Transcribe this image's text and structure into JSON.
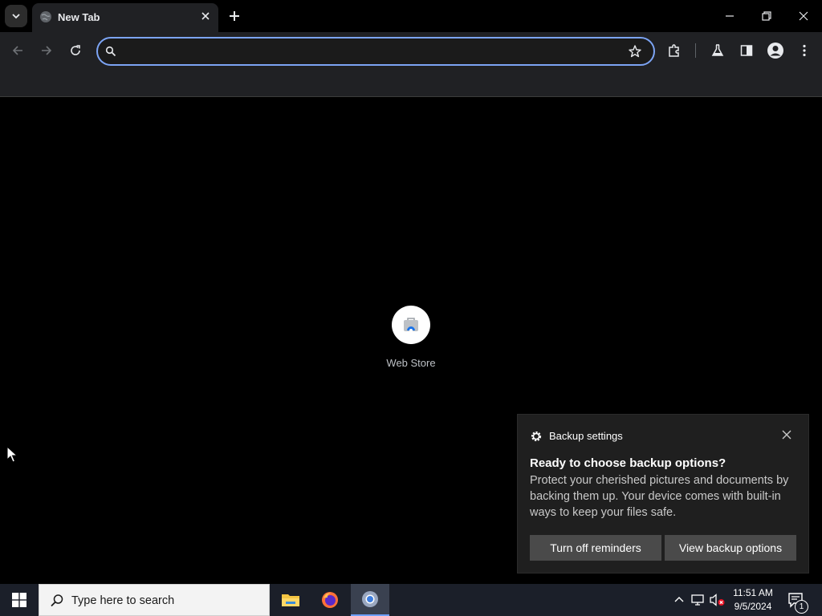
{
  "browser": {
    "tab": {
      "title": "New Tab"
    },
    "omnibox": {
      "value": "",
      "placeholder": ""
    }
  },
  "page": {
    "shortcuts": [
      {
        "label": "Web Store"
      }
    ]
  },
  "notification": {
    "app_name": "Backup settings",
    "heading": "Ready to choose backup options?",
    "body": "Protect your cherished pictures and documents by backing them up. Your device comes with built-in ways to keep your files safe.",
    "buttons": {
      "turn_off": "Turn off reminders",
      "view": "View backup options"
    }
  },
  "taskbar": {
    "search_placeholder": "Type here to search",
    "clock": {
      "time": "11:51 AM",
      "date": "9/5/2024"
    },
    "notification_count": "1"
  },
  "colors": {
    "accent": "#7ca4f4",
    "toolbar_bg": "#202124",
    "toast_bg": "#1f1f1f",
    "toast_button": "#4a4a4a",
    "taskbar_bg": "#1b1f29"
  }
}
